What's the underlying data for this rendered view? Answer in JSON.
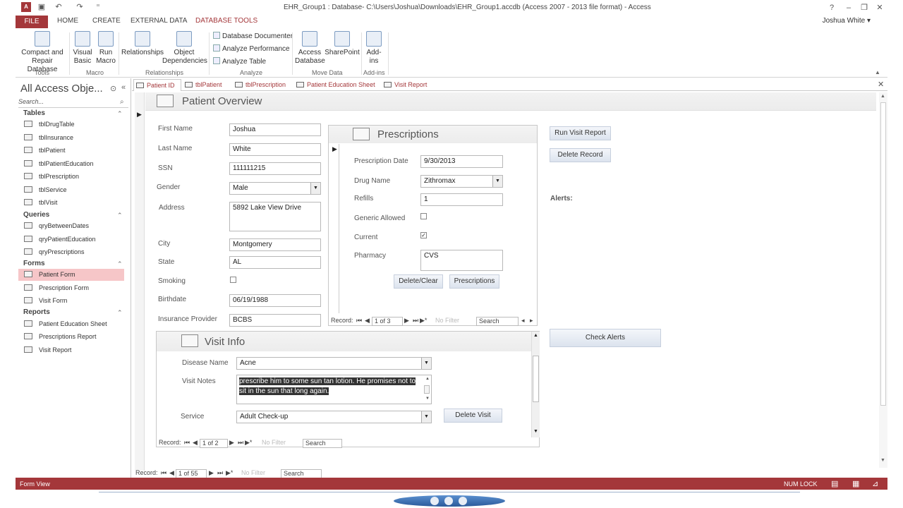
{
  "window": {
    "title": "EHR_Group1 : Database- C:\\Users\\Joshua\\Downloads\\EHR_Group1.accdb (Access 2007 - 2013 file format) - Access",
    "app_icon": "A",
    "user": "Joshua White ▾"
  },
  "ribbon_tabs": [
    "FILE",
    "HOME",
    "CREATE",
    "EXTERNAL DATA",
    "DATABASE TOOLS"
  ],
  "ribbon": {
    "compact": "Compact and Repair Database",
    "visual_basic": "Visual Basic",
    "run_macro": "Run Macro",
    "relationships": "Relationships",
    "object_dependencies": "Object Dependencies",
    "database_documenter": "Database Documenter",
    "analyze_performance": "Analyze Performance",
    "analyze_table": "Analyze Table",
    "access_database": "Access Database",
    "sharepoint": "SharePoint",
    "addins": "Add-ins",
    "groups": [
      "Tools",
      "Macro",
      "Relationships",
      "Analyze",
      "Move Data",
      "Add-ins"
    ]
  },
  "nav": {
    "title": "All Access Obje...",
    "search_placeholder": "Search...",
    "tables_label": "Tables",
    "tables": [
      "tblDrugTable",
      "tblInsurance",
      "tblPatient",
      "tblPatientEducation",
      "tblPrescription",
      "tblService",
      "tblVisit"
    ],
    "queries_label": "Queries",
    "queries": [
      "qryBetweenDates",
      "qryPatientEducation",
      "qryPrescriptions"
    ],
    "forms_label": "Forms",
    "forms": [
      "Patient Form",
      "Prescription Form",
      "Visit Form"
    ],
    "reports_label": "Reports",
    "reports": [
      "Patient Education Sheet",
      "Prescriptions Report",
      "Visit Report"
    ]
  },
  "doc_tabs": [
    "Patient ID",
    "tblPatient",
    "tblPrescription",
    "Patient Education Sheet",
    "Visit Report"
  ],
  "form": {
    "title": "Patient Overview",
    "labels": {
      "first_name": "First Name",
      "last_name": "Last Name",
      "ssn": "SSN",
      "gender": "Gender",
      "address": "Address",
      "city": "City",
      "state": "State",
      "smoking": "Smoking",
      "birthdate": "Birthdate",
      "insurance": "Insurance Provider"
    },
    "values": {
      "first_name": "Joshua",
      "last_name": "White",
      "ssn": "111111215",
      "gender": "Male",
      "address": "5892 Lake View Drive",
      "city": "Montgomery",
      "state": "AL",
      "birthdate": "06/19/1988",
      "insurance": "BCBS"
    },
    "buttons": {
      "run_visit_report": "Run Visit Report",
      "delete_record": "Delete Record",
      "check_alerts": "Check Alerts"
    },
    "alerts_label": "Alerts:",
    "record_nav": {
      "label": "Record:",
      "pos": "1 of 55",
      "search": "Search",
      "filter": "No Filter"
    }
  },
  "prescriptions": {
    "title": "Prescriptions",
    "labels": {
      "date": "Prescription Date",
      "drug": "Drug Name",
      "refills": "Refills",
      "generic": "Generic Allowed",
      "current": "Current",
      "pharmacy": "Pharmacy"
    },
    "values": {
      "date": "9/30/2013",
      "drug": "Zithromax",
      "refills": "1",
      "pharmacy": "CVS"
    },
    "generic_checked": false,
    "current_checked": true,
    "buttons": {
      "delete_clear": "Delete/Clear",
      "prescriptions": "Prescriptions"
    },
    "record_nav": {
      "label": "Record:",
      "pos": "1 of 3",
      "search": "Search",
      "filter": "No Filter"
    }
  },
  "visit": {
    "title": "Visit Info",
    "labels": {
      "disease": "Disease Name",
      "notes": "Visit Notes",
      "service": "Service"
    },
    "values": {
      "disease": "Acne",
      "notes": "prescribe him to some sun tan lotion. He promises not to sit in the sun that long again.",
      "service": "Adult Check-up"
    },
    "buttons": {
      "delete_visit": "Delete Visit"
    },
    "record_nav": {
      "label": "Record:",
      "pos": "1 of 2",
      "search": "Search",
      "filter": "No Filter"
    }
  },
  "status": {
    "left": "Form View",
    "numlock": "NUM LOCK"
  },
  "colors": {
    "accent": "#a4373a",
    "selected_nav": "#f6c6c8"
  }
}
